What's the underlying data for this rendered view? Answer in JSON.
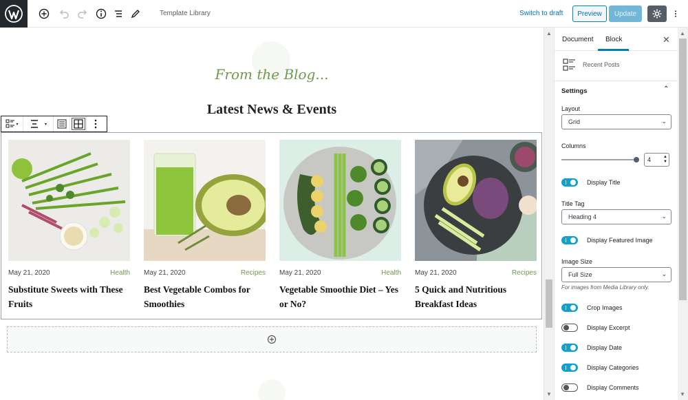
{
  "topbar": {
    "title": "Template Library",
    "switch_draft": "Switch to draft",
    "preview": "Preview",
    "update": "Update"
  },
  "editor": {
    "blog_heading": "From the Blog...",
    "news_heading": "Latest News & Events",
    "posts": [
      {
        "date": "May 21, 2020",
        "category": "Health",
        "title": "Substitute Sweets with These Fruits"
      },
      {
        "date": "May 21, 2020",
        "category": "Recipes",
        "title": "Best Vegetable Combos for Smoothies"
      },
      {
        "date": "May 21, 2020",
        "category": "Health",
        "title": "Vegetable Smoothie Diet – Yes or No?"
      },
      {
        "date": "May 21, 2020",
        "category": "Recipes",
        "title": "5 Quick and Nutritious Breakfast Ideas"
      }
    ]
  },
  "sidebar": {
    "tabs": [
      "Document",
      "Block"
    ],
    "active_tab": "Block",
    "block_name": "Recent Posts",
    "settings_label": "Settings",
    "layout_label": "Layout",
    "layout_value": "Grid",
    "columns_label": "Columns",
    "columns_value": "4",
    "display_title": "Display Title",
    "title_tag_label": "Title Tag",
    "title_tag_value": "Heading 4",
    "display_featured_image": "Display Featured Image",
    "image_size_label": "Image Size",
    "image_size_value": "Full Size",
    "image_size_help": "For images from Media Library only.",
    "crop_images": "Crop Images",
    "display_excerpt": "Display Excerpt",
    "display_date": "Display Date",
    "display_categories": "Display Categories",
    "display_comments": "Display Comments"
  },
  "colors": {
    "accent": "#007cba",
    "toggle_on": "#11a0d2",
    "heading_green": "#6e9a4e"
  }
}
